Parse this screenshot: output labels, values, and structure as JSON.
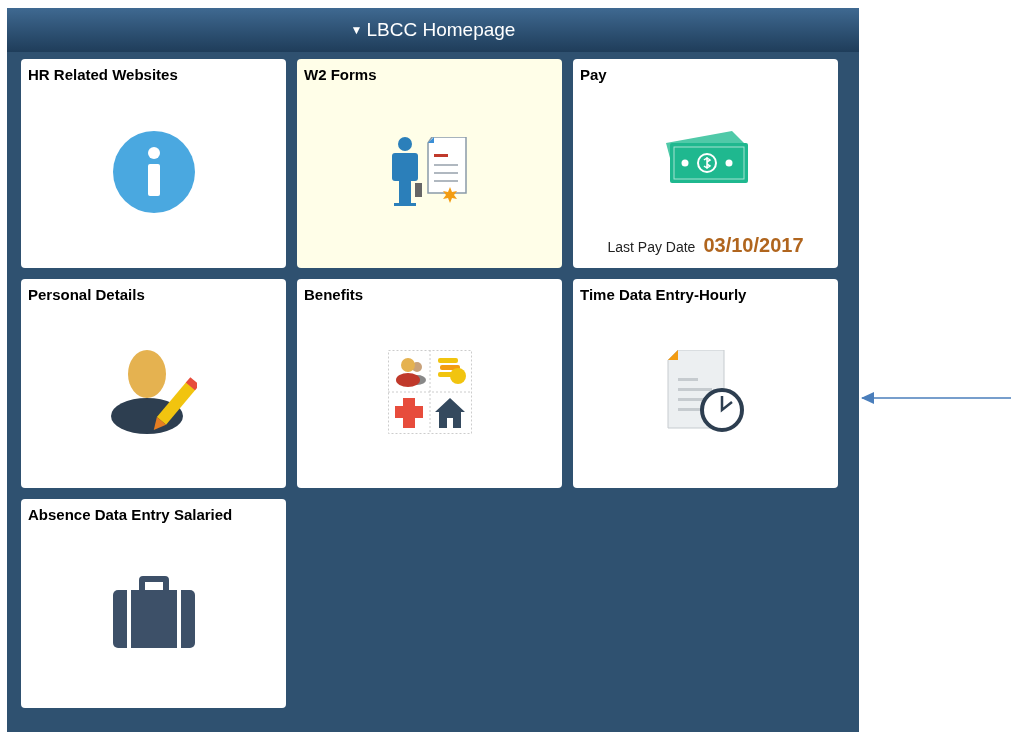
{
  "header": {
    "title": "LBCC Homepage",
    "caret": "▼"
  },
  "tiles": [
    {
      "title": "HR Related Websites",
      "kind": "info",
      "highlighted": false
    },
    {
      "title": "W2 Forms",
      "kind": "forms",
      "highlighted": true
    },
    {
      "title": "Pay",
      "kind": "pay",
      "highlighted": false,
      "detail_label": "Last Pay Date",
      "detail_value": "03/10/2017"
    },
    {
      "title": "Personal Details",
      "kind": "person",
      "highlighted": false
    },
    {
      "title": "Benefits",
      "kind": "benefits",
      "highlighted": false
    },
    {
      "title": "Time Data Entry-Hourly",
      "kind": "timesheet",
      "highlighted": false
    },
    {
      "title": "Absence Data Entry Salaried",
      "kind": "briefcase",
      "highlighted": false
    }
  ]
}
